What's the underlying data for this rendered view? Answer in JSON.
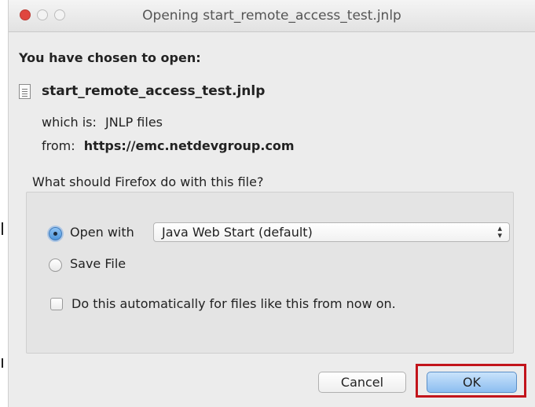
{
  "window": {
    "title": "Opening start_remote_access_test.jnlp"
  },
  "dialog": {
    "heading": "You have chosen to open:",
    "file_name": "start_remote_access_test.jnlp",
    "which_is_label": "which is:",
    "which_is_value": "JNLP files",
    "from_label": "from:",
    "from_value": "https://emc.netdevgroup.com",
    "question": "What should Firefox do with this file?",
    "open_with_label": "Open with",
    "open_with_selected": "Java Web Start (default)",
    "open_with_checked": true,
    "save_file_label": "Save File",
    "save_file_checked": false,
    "auto_label": "Do this automatically for files like this from now on.",
    "auto_checked": false
  },
  "buttons": {
    "cancel": "Cancel",
    "ok": "OK"
  },
  "colors": {
    "highlight": "#c2141b",
    "ok_button": "#8cbdf0"
  }
}
